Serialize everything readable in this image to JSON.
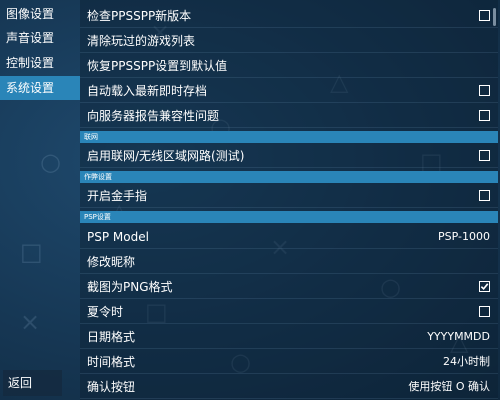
{
  "sidebar": {
    "items": [
      {
        "label": "图像设置",
        "active": false
      },
      {
        "label": "声音设置",
        "active": false
      },
      {
        "label": "控制设置",
        "active": false
      },
      {
        "label": "系统设置",
        "active": true
      }
    ],
    "back_label": "返回"
  },
  "settings": {
    "top": [
      {
        "label": "检查PPSSPP新版本",
        "checked": false
      },
      {
        "label": "清除玩过的游戏列表"
      },
      {
        "label": "恢复PPSSPP设置到默认值"
      },
      {
        "label": "自动载入最新即时存档",
        "checked": false
      },
      {
        "label": "向服务器报告兼容性问题",
        "checked": false
      }
    ],
    "network": {
      "header": "联网",
      "items": [
        {
          "label": "启用联网/无线区域网路(测试)",
          "checked": false
        }
      ]
    },
    "cheats": {
      "header": "作弊设置",
      "items": [
        {
          "label": "开启金手指",
          "checked": false
        }
      ]
    },
    "psp": {
      "header": "PSP设置",
      "items": [
        {
          "label": "PSP Model",
          "value": "PSP-1000"
        },
        {
          "label": "修改昵称"
        },
        {
          "label": "截图为PNG格式",
          "checked": true
        },
        {
          "label": "夏令时",
          "checked": false
        },
        {
          "label": "日期格式",
          "value": "YYYYMMDD"
        },
        {
          "label": "时间格式",
          "value": "24小时制"
        },
        {
          "label": "确认按钮",
          "value": "使用按钮 O 确认"
        }
      ]
    }
  },
  "colors": {
    "accent": "#2a85b8",
    "background": "#163754"
  }
}
